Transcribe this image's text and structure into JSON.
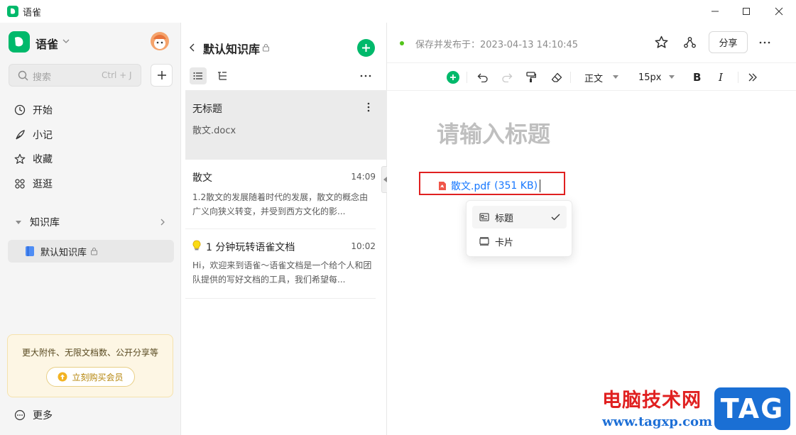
{
  "titlebar": {
    "app_name": "语雀"
  },
  "sidebar": {
    "brand": "语雀",
    "search": {
      "placeholder": "搜索",
      "shortcut": "Ctrl + J"
    },
    "nav": [
      {
        "label": "开始",
        "icon": "clock-icon"
      },
      {
        "label": "小记",
        "icon": "feather-icon"
      },
      {
        "label": "收藏",
        "icon": "star-icon"
      },
      {
        "label": "逛逛",
        "icon": "grid-icon"
      }
    ],
    "kb_section": "知识库",
    "kb_item": "默认知识库",
    "promo": {
      "text": "更大附件、无限文档数、公开分享等",
      "button": "立刻购买会员"
    },
    "more": "更多"
  },
  "list": {
    "title": "默认知识库",
    "docs": [
      {
        "title": "无标题",
        "subtitle": "散文.docx",
        "time": ""
      },
      {
        "title": "散文",
        "time": "14:09",
        "preview": "1.2散文的发展随着时代的发展，散文的概念由广义向狭义转变，并受到西方文化的影..."
      },
      {
        "title": "1 分钟玩转语雀文档",
        "time": "10:02",
        "preview": "Hi，欢迎来到语雀～语雀文档是一个给个人和团队提供的写好文档的工具，我们希望每..."
      }
    ]
  },
  "editor": {
    "status": "保存并发布于：2023-04-13 14:10:45",
    "share": "分享",
    "toolbar": {
      "style": "正文",
      "size": "15px",
      "bold": "B",
      "italic": "I"
    },
    "title_placeholder": "请输入标题",
    "attachment": {
      "name": "散文.pdf",
      "size": "(351 KB)"
    },
    "menu": [
      {
        "label": "标题",
        "checked": true
      },
      {
        "label": "卡片",
        "checked": false
      }
    ]
  },
  "watermark": {
    "site": "电脑技术网",
    "url": "www.tagxp.com",
    "logo": "TAG"
  },
  "colors": {
    "brand": "#00b96b",
    "link": "#1677ff",
    "highlight_box": "#e02020",
    "status_dot": "#52c41a"
  }
}
